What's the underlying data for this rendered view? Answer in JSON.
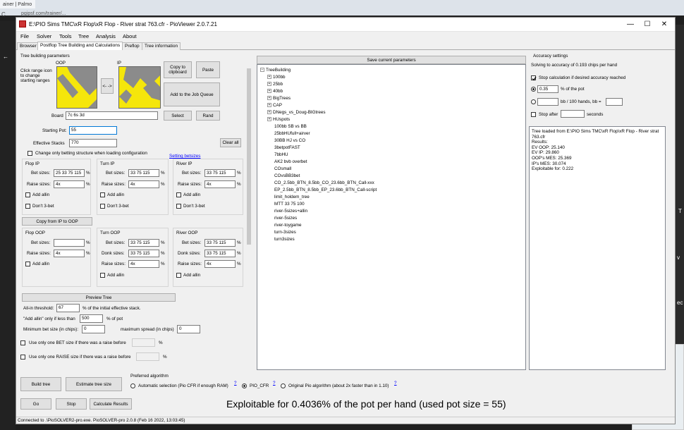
{
  "browser": {
    "tab_label": "ainer | Palmo",
    "url": "pgipsf.com/trainer/...",
    "back_glyph": "C",
    "side_glyphs": [
      "←",
      "R",
      "T",
      "v",
      ":",
      "ec",
      "V"
    ]
  },
  "window": {
    "title": "E:\\PIO Sims TMC\\xR Flop\\xR Flop - River strat 763.cfr - PioViewer 2.0.7.21",
    "minimize": "—",
    "maximize": "☐",
    "close": "✕"
  },
  "menu": [
    "File",
    "Solver",
    "Tools",
    "Tree",
    "Analysis",
    "About"
  ],
  "tabs": [
    "Browser",
    "Postflop Tree Building and Calculations",
    "Preflop",
    "Tree information"
  ],
  "left": {
    "section_title": "Tree building parameters",
    "oop_label": "OOP",
    "ip_label": "IP",
    "click_range_hint": "Click range icon to change starting ranges",
    "swap_glyph": "<- ->",
    "copy_clipboard": "Copy to clipboard",
    "paste": "Paste",
    "add_job_queue": "Add to the Job Queue",
    "board_label": "Board",
    "board_value": "7c 6s 3d",
    "select": "Select",
    "rand": "Rand",
    "starting_pot_label": "Starting Pot:",
    "starting_pot_value": "55",
    "effective_stacks_label": "Effective Stacks",
    "effective_stacks_value": "770",
    "clear_all": "Clear all",
    "change_only_betting": "Change only betting structure when loading configuration",
    "setting_betsizes": "Setting betsizes",
    "flop_ip": "Flop IP",
    "turn_ip": "Turn IP",
    "river_ip": "River IP",
    "bet_sizes_label": "Bet sizes:",
    "raise_sizes_label": "Raise sizes:",
    "donk_sizes_label": "Donk sizes:",
    "pct": "%",
    "add_allin": "Add allin",
    "dont_3bet": "Don't 3-bet",
    "flop_ip_bet": "25 33 75 115",
    "flop_ip_raise": "4x",
    "turn_ip_bet": "33 75 115",
    "turn_ip_raise": "4x",
    "river_ip_bet": "33 75 115",
    "river_ip_raise": "4x",
    "copy_ip_to_oop": "Copy from IP to OOP",
    "flop_oop": "Flop OOP",
    "turn_oop": "Turn OOP",
    "river_oop": "River OOP",
    "flop_oop_bet": "",
    "flop_oop_raise": "4x",
    "turn_oop_bet": "33 75 115",
    "turn_oop_donk": "33 75 115",
    "turn_oop_raise": "4x",
    "river_oop_bet": "33 75 115",
    "river_oop_donk": "33 75 115",
    "river_oop_raise": "4x",
    "preview_tree": "Preview Tree",
    "allin_threshold_label": "All-in threshold:",
    "allin_threshold_value": "67",
    "allin_threshold_suffix": "% of the initial effective stack.",
    "add_allin_only_label": "\"Add allin\" only if less than",
    "add_allin_only_value": "500",
    "add_allin_only_suffix": "% of pot",
    "min_bet_label": "Minimum bet size (in chips):",
    "min_bet_value": "0",
    "max_spread_label": "maximum spread (in chips)",
    "max_spread_value": "0",
    "one_bet_label": "Use only one BET size if there was a raise before",
    "one_raise_label": "Use only one RAISE size if there was a raise before",
    "build_tree": "Build tree",
    "estimate_tree_size": "Estimate tree size",
    "go": "Go",
    "stop": "Stop",
    "calculate_results": "Calculate Results"
  },
  "middle": {
    "save_params": "Save current parameters",
    "tree_root": "TreeBuilding",
    "tree_folders": [
      "100bb",
      "25bb",
      "40bb",
      "BigTrees",
      "CAP",
      "DNegs_vs_Doug-BIGtrees",
      "HUspots"
    ],
    "tree_items": [
      "100bb SB vs BB",
      "25bbHUfull+airver",
      "30BB HJ vs CO",
      "3betpotFAST",
      "7bbHU",
      "AK2 bvb overbet",
      "COsmall",
      "COvsBB3bet",
      "CO_2.5bb_BTN_8.5bb_CO_23.6bb_BTN_Call-xxx",
      "EP_2.5bb_BTN_8.5bb_EP_23.6bb_BTN_Call-script",
      "limit_holdem_tree",
      "MTT 33 75 100",
      "river-5sizes+allin",
      "river-5sizes",
      "river-toygame",
      "turn-3sizes",
      "turn3sizes"
    ]
  },
  "algo": {
    "title": "Preferred algorithm",
    "auto": "Automatic selection (Pio CFR if enough RAM)",
    "pio_cfr": "PIO_CFR",
    "original": "Original Pio algorithm (about 2x faster than in 1.10)",
    "q": "?"
  },
  "right": {
    "title": "Accuracy settings",
    "solving_to": "Solving to accuracy of 0.193 chips per hand",
    "stop_calc": "Stop calculation if desired accuracy reached",
    "pct_value": "0.35",
    "pct_label": "% of the pot",
    "bb_label": "bb / 100 hands, bb =",
    "stop_after": "Stop after",
    "seconds": "seconds",
    "results_lines": [
      "Tree loaded from E:\\PIO Sims TMC\\xR Flop\\xR Flop - River strat 763.cfr",
      "Results:",
      "EV OOP: 25.140",
      "EV IP: 29.860",
      "OOP's MES: 25.369",
      "IP's MES: 30.074",
      "Exploitable for: 0.222"
    ]
  },
  "exploitable_text": "Exploitable for 0.4036% of the pot per hand (used pot size = 55)",
  "status": "Connected to .\\PioSOLVER2-pro.exe. PioSOLVER-pro 2.0.8 (Feb 16 2022, 13:03:45)"
}
